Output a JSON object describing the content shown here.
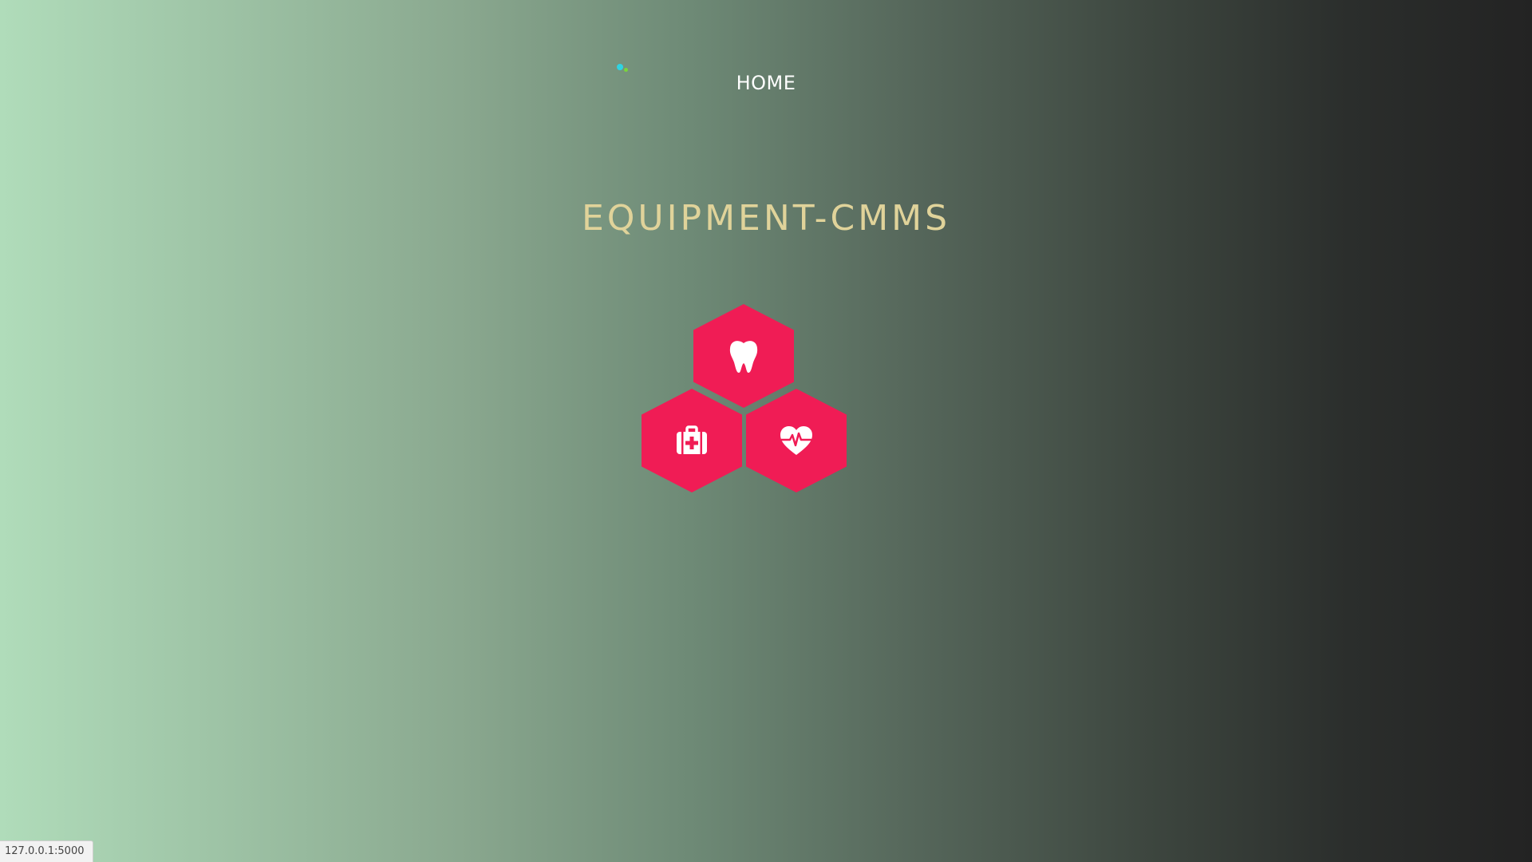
{
  "nav": {
    "home_label": "HOME"
  },
  "header": {
    "title": "Equipment-CMMS"
  },
  "tiles": [
    {
      "icon": "tooth-icon",
      "color": "#f01c55"
    },
    {
      "icon": "medical-kit-icon",
      "color": "#f01c55"
    },
    {
      "icon": "heartbeat-icon",
      "color": "#f01c55"
    }
  ],
  "status_bar": {
    "url": "127.0.0.1:5000"
  },
  "colors": {
    "title": "#e0d39a",
    "tile": "#f01c55",
    "logo_dot_1": "#2fd3e2",
    "logo_dot_2": "#7bd43c",
    "gradient_start": "#b0dcba",
    "gradient_end": "#232323"
  }
}
